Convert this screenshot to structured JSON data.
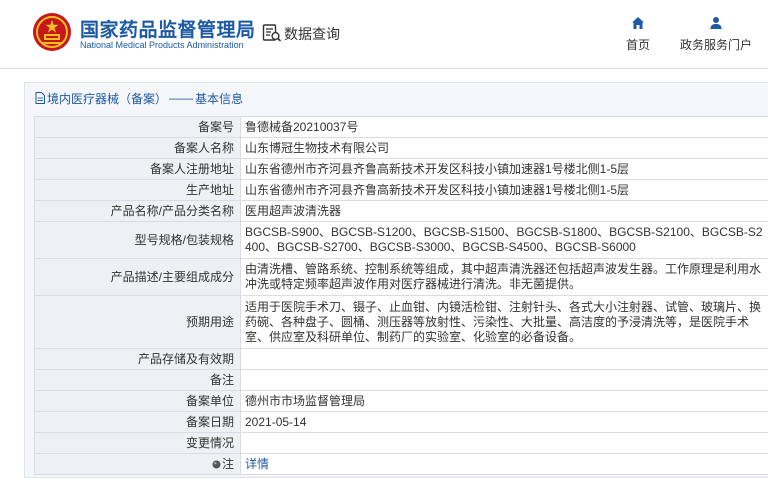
{
  "header": {
    "logo_cn": "国家药品监督管理局",
    "logo_en": "National Medical Products Administration",
    "db_title": "数据查询",
    "nav": {
      "home_label": "首页",
      "portal_label": "政务服务门户"
    }
  },
  "breadcrumb": {
    "section": "境内医疗器械（备案）",
    "separator": "——",
    "current": "基本信息"
  },
  "rows": [
    {
      "label": "备案号",
      "value": "鲁德械备20210037号"
    },
    {
      "label": "备案人名称",
      "value": "山东博冠生物技术有限公司"
    },
    {
      "label": "备案人注册地址",
      "value": "山东省德州市齐河县齐鲁高新技术开发区科技小镇加速器1号楼北侧1-5层"
    },
    {
      "label": "生产地址",
      "value": "山东省德州市齐河县齐鲁高新技术开发区科技小镇加速器1号楼北侧1-5层"
    },
    {
      "label": "产品名称/产品分类名称",
      "value": "医用超声波清洗器"
    },
    {
      "label": "型号规格/包装规格",
      "value": "BGCSB-S900、BGCSB-S1200、BGCSB-S1500、BGCSB-S1800、BGCSB-S2100、BGCSB-S2400、BGCSB-S2700、BGCSB-S3000、BGCSB-S4500、BGCSB-S6000"
    },
    {
      "label": "产品描述/主要组成成分",
      "value": "由清洗槽、管路系统、控制系统等组成，其中超声清洗器还包括超声波发生器。工作原理是利用水冲洗或特定频率超声波作用对医疗器械进行清洗。非无菌提供。"
    },
    {
      "label": "预期用途",
      "value": "适用于医院手术刀、镊子、止血钳、内镜活检钳、注射针头、各式大小注射器、试管、玻璃片、换药碗、各种盘子、圆桶、测压器等放射性、污染性、大批量、高洁度的予浸清洗等，是医院手术室、供应室及科研单位、制药厂的实验室、化验室的必备设备。"
    },
    {
      "label": "产品存储及有效期",
      "value": ""
    },
    {
      "label": "备注",
      "value": ""
    },
    {
      "label": "备案单位",
      "value": "德州市市场监督管理局"
    },
    {
      "label": "备案日期",
      "value": "2021-05-14"
    },
    {
      "label": "变更情况",
      "value": ""
    }
  ],
  "note_row": {
    "label": "注",
    "link": "详情",
    "icon": "info-dot-icon"
  },
  "colors": {
    "brand_blue": "#1d5aa5",
    "emblem_red": "#c8161d",
    "emblem_gold": "#f2c01e",
    "label_bg": "#eef0f3",
    "panel_bg": "#f4f6f9"
  }
}
